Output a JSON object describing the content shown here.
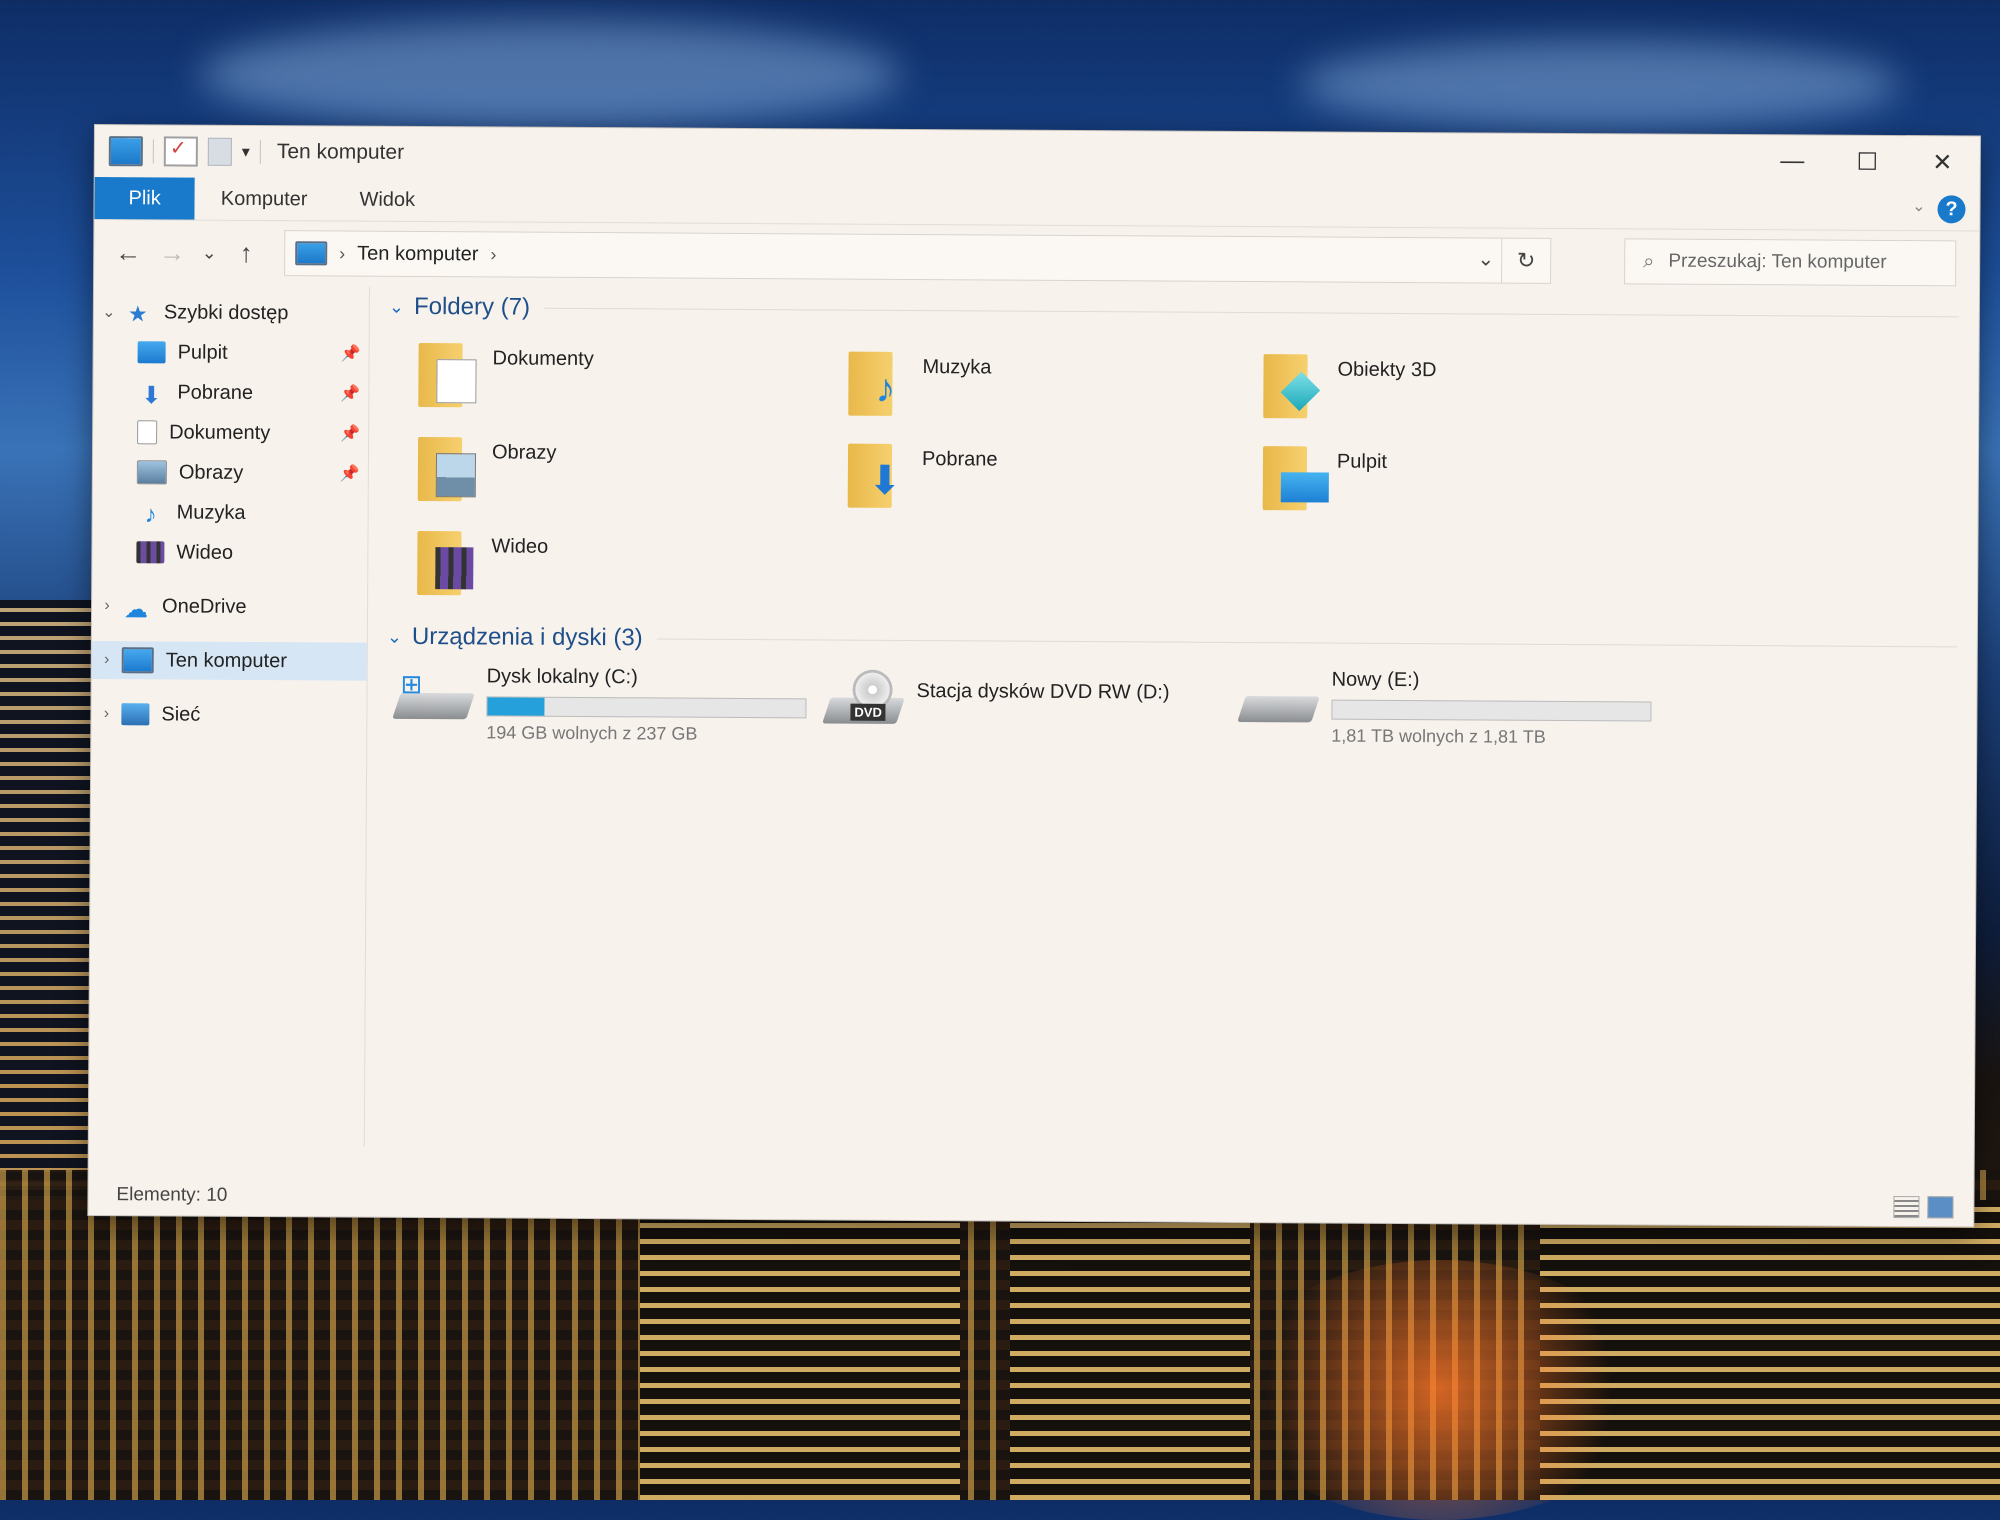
{
  "window": {
    "title": "Ten komputer",
    "controls": {
      "minimize": "—",
      "maximize": "☐",
      "close": "✕"
    }
  },
  "ribbon": {
    "tabs": [
      {
        "label": "Plik",
        "active": true
      },
      {
        "label": "Komputer",
        "active": false
      },
      {
        "label": "Widok",
        "active": false
      }
    ],
    "help": "?"
  },
  "navigation": {
    "back": "←",
    "forward": "→",
    "recent": "⌄",
    "up": "↑",
    "breadcrumb": [
      "Ten komputer"
    ],
    "refresh": "↻",
    "dropdown": "⌄"
  },
  "search": {
    "placeholder": "Przeszukaj: Ten komputer"
  },
  "sidebar": {
    "items": [
      {
        "label": "Szybki dostęp",
        "icon": "quick-access-star-icon",
        "expanded": true
      },
      {
        "label": "Pulpit",
        "icon": "desktop-icon",
        "pinned": true
      },
      {
        "label": "Pobrane",
        "icon": "downloads-icon",
        "pinned": true
      },
      {
        "label": "Dokumenty",
        "icon": "documents-icon",
        "pinned": true
      },
      {
        "label": "Obrazy",
        "icon": "pictures-icon",
        "pinned": true
      },
      {
        "label": "Muzyka",
        "icon": "music-icon"
      },
      {
        "label": "Wideo",
        "icon": "video-icon"
      },
      {
        "label": "OneDrive",
        "icon": "onedrive-cloud-icon"
      },
      {
        "label": "Ten komputer",
        "icon": "this-pc-icon",
        "selected": true
      },
      {
        "label": "Sieć",
        "icon": "network-icon"
      }
    ]
  },
  "folders": {
    "title": "Foldery (7)",
    "items": [
      {
        "label": "Dokumenty",
        "icon": "documents-folder-icon"
      },
      {
        "label": "Muzyka",
        "icon": "music-folder-icon"
      },
      {
        "label": "Obiekty 3D",
        "icon": "3d-objects-folder-icon"
      },
      {
        "label": "Obrazy",
        "icon": "pictures-folder-icon"
      },
      {
        "label": "Pobrane",
        "icon": "downloads-folder-icon"
      },
      {
        "label": "Pulpit",
        "icon": "desktop-folder-icon"
      },
      {
        "label": "Wideo",
        "icon": "video-folder-icon"
      }
    ]
  },
  "drives": {
    "title": "Urządzenia i dyski (3)",
    "items": [
      {
        "label": "Dysk lokalny (C:)",
        "free": "194 GB wolnych z 237 GB",
        "used_fraction": 0.18,
        "icon": "windows-drive-icon"
      },
      {
        "label": "Stacja dysków DVD RW (D:)",
        "icon": "dvd-drive-icon",
        "dvd_label": "DVD"
      },
      {
        "label": "Nowy (E:)",
        "free": "1,81 TB wolnych z 1,81 TB",
        "used_fraction": 0.0,
        "icon": "hard-drive-icon"
      }
    ]
  },
  "status": {
    "items": "Elementy: 10"
  },
  "colors": {
    "accent": "#1979ca",
    "progress": "#26a0da",
    "selection": "#d6e6f5"
  }
}
